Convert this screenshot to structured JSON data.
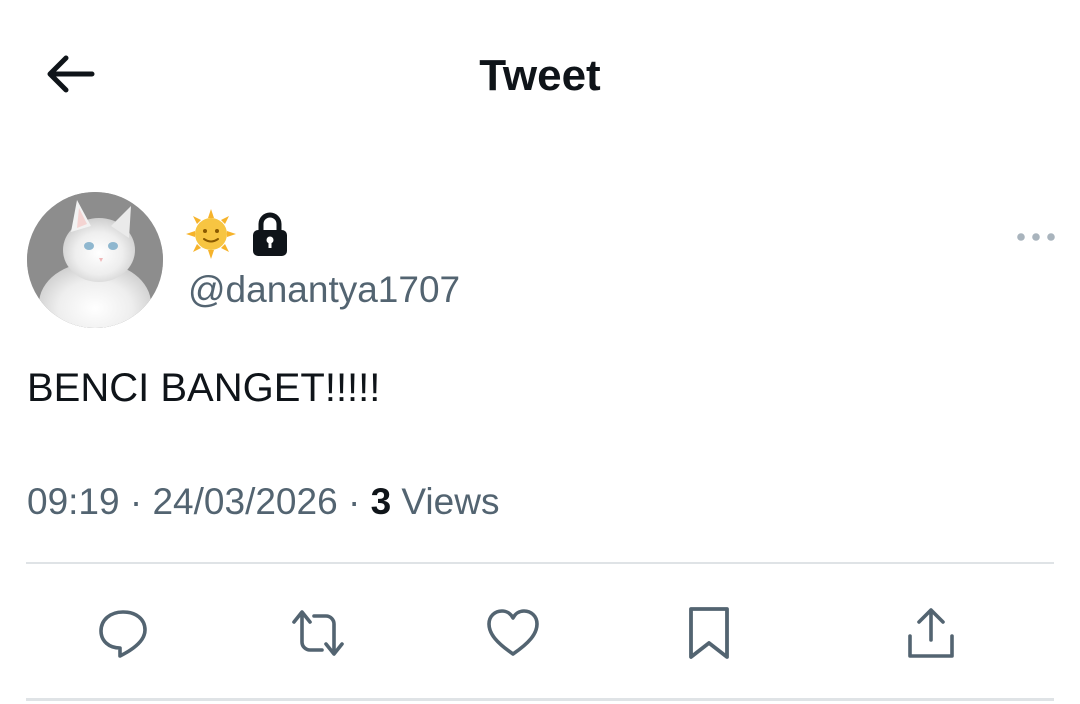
{
  "header": {
    "title": "Tweet",
    "back_icon": "arrow-left-icon"
  },
  "tweet": {
    "author": {
      "display_name_emoji": "sun-with-face-emoji",
      "protected_icon": "lock-icon",
      "handle": "@danantya1707",
      "avatar": "white-kitten-photo"
    },
    "text": "BENCI BANGET!!!!!",
    "time": "09:19",
    "separator": "·",
    "date": "24/03/2026",
    "views_count": "3",
    "views_label": "Views"
  },
  "actions": [
    {
      "name": "reply",
      "icon": "reply-icon"
    },
    {
      "name": "retweet",
      "icon": "retweet-icon"
    },
    {
      "name": "like",
      "icon": "heart-icon"
    },
    {
      "name": "bookmark",
      "icon": "bookmark-icon"
    },
    {
      "name": "share",
      "icon": "share-icon"
    }
  ],
  "colors": {
    "text_primary": "#0f1419",
    "text_secondary": "#536471",
    "divider": "#dfe3e6",
    "sun": "#f6b32b"
  }
}
